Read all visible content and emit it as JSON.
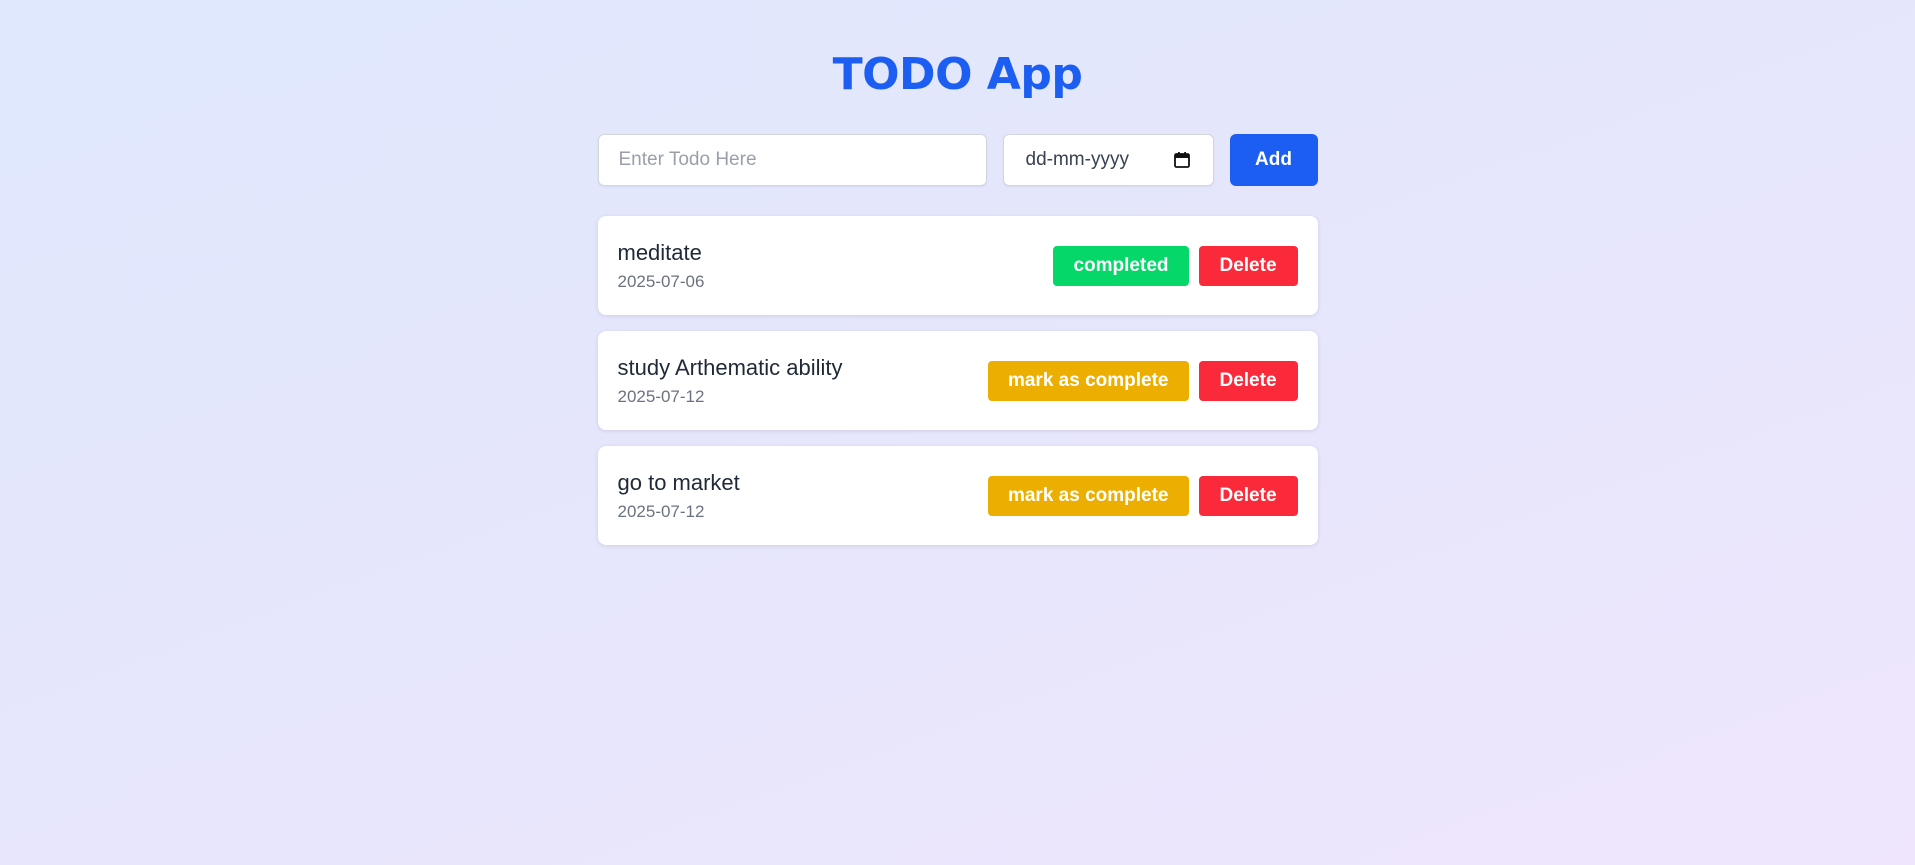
{
  "app": {
    "title": "TODO App"
  },
  "form": {
    "todo_placeholder": "Enter Todo Here",
    "date_placeholder": "dd-mm-yyyy",
    "add_label": "Add"
  },
  "todos": [
    {
      "name": "meditate",
      "date": "2025-07-06",
      "status_label": "completed",
      "status": "completed",
      "delete_label": "Delete"
    },
    {
      "name": "study Arthematic ability",
      "date": "2025-07-12",
      "status_label": "mark as complete",
      "status": "pending",
      "delete_label": "Delete"
    },
    {
      "name": "go to market",
      "date": "2025-07-12",
      "status_label": "mark as complete",
      "status": "pending",
      "delete_label": "Delete"
    }
  ],
  "colors": {
    "accent": "#1d5ef2",
    "completed": "#05d868",
    "pending": "#ecae00",
    "delete": "#fa2a3a"
  },
  "icons": {
    "date_picker": "calendar-icon"
  }
}
